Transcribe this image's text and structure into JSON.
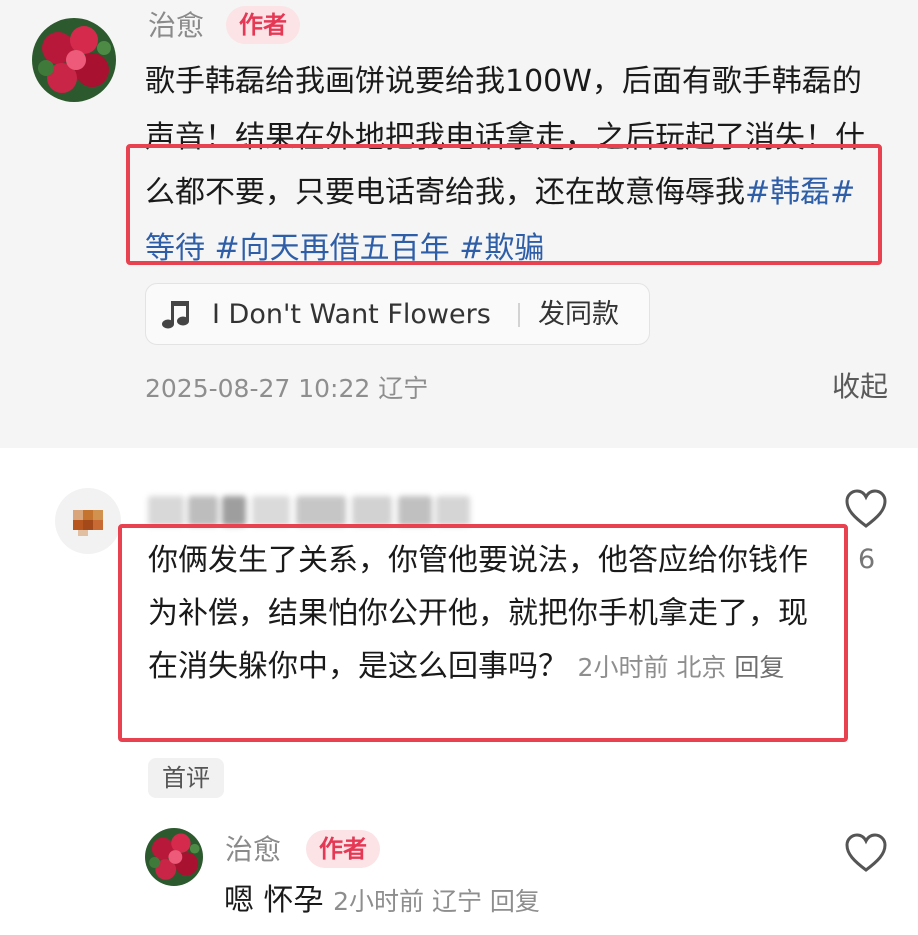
{
  "post": {
    "username": "治愈",
    "author_badge": "作者",
    "text_main": "歌手韩磊给我画饼说要给我100W，后面有歌手韩磊的声音！结果在外地把我电话拿走，之后玩起了消失！什么都不要，只要电话寄给我，还在故意侮辱我",
    "hashtags": [
      "#韩磊",
      "#等待",
      "#向天再借五百年",
      "#欺骗"
    ],
    "music_title": "I Don't Want Flowers",
    "music_action": "发同款",
    "date": "2025-08-27 10:22",
    "location": "辽宁",
    "collapse_label": "收起"
  },
  "comment": {
    "text": "你俩发生了关系，你管他要说法，他答应给你钱作为补偿，结果怕你公开他，就把你手机拿走了，现在消失躲你中，是这么回事吗？",
    "time": "2小时前",
    "location": "北京",
    "reply_label": "回复",
    "like_count": "6",
    "first_tag": "首评"
  },
  "reply": {
    "username": "治愈",
    "author_badge": "作者",
    "text": "嗯 怀孕",
    "time": "2小时前",
    "location": "辽宁",
    "reply_label": "回复"
  },
  "colors": {
    "hashtag": "#2f5ea8",
    "badge_text": "#e53855",
    "badge_bg": "#fbe3e6",
    "highlight_box": "#e8414f"
  },
  "icons": [
    "music-note-icon",
    "heart-outline-icon"
  ]
}
